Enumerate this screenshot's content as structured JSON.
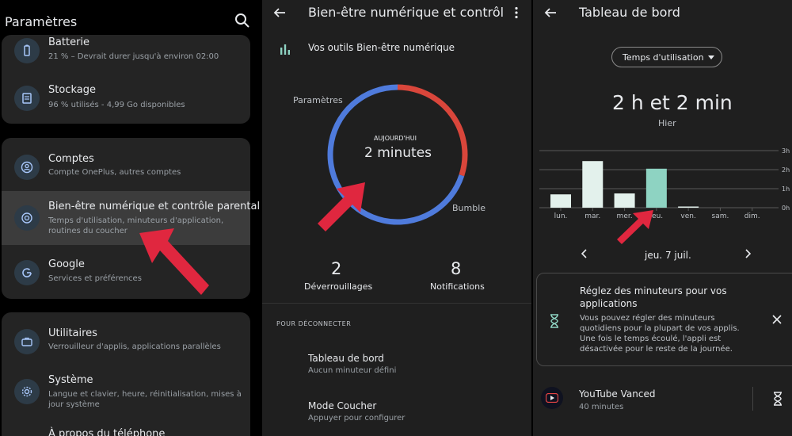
{
  "settings": {
    "title": "Paramètres",
    "items": [
      {
        "title": "Batterie",
        "subtitle": "21 % – Devrait durer jusqu'à environ 02:00"
      },
      {
        "title": "Stockage",
        "subtitle": "96 % utilisés - 4,99 Go disponibles"
      },
      {
        "title": "Comptes",
        "subtitle": "Compte OnePlus, autres comptes"
      },
      {
        "title": "Bien-être numérique et contrôle parental",
        "subtitle": "Temps d'utilisation, minuteurs d'application, routines du coucher"
      },
      {
        "title": "Google",
        "subtitle": "Services et préférences"
      },
      {
        "title": "Utilitaires",
        "subtitle": "Verrouilleur d'applis, applications parallèles"
      },
      {
        "title": "Système",
        "subtitle": "Langue et clavier, heure, réinitialisation, mises à jour système"
      },
      {
        "title": "À propos du téléphone",
        "subtitle": ""
      }
    ]
  },
  "wellbeing": {
    "title": "Bien-être numérique et contrôle parental",
    "tools_label": "Vos outils Bien-être numérique",
    "donut": {
      "today_label": "AUJOURD'HUI",
      "value": "2 minutes",
      "segments": [
        {
          "label": "Parametres",
          "fraction": 0.3,
          "color": "#d9463b"
        },
        {
          "label": "Bumble",
          "fraction": 0.7,
          "color": "#4f7bdc"
        }
      ]
    },
    "labels": {
      "parametres": "Paramètres",
      "bumble": "Bumble"
    },
    "stats": {
      "unlocks_value": "2",
      "unlocks_label": "Déverrouillages",
      "notifications_value": "8",
      "notifications_label": "Notifications"
    },
    "section_disconnect": "POUR DÉCONNECTER",
    "items": [
      {
        "title": "Tableau de bord",
        "subtitle": "Aucun minuteur défini"
      },
      {
        "title": "Mode Coucher",
        "subtitle": "Appuyer pour configurer"
      }
    ]
  },
  "dashboard": {
    "title": "Tableau de bord",
    "dropdown": "Temps d'utilisation",
    "total": "2 h et 2 min",
    "period": "Hier",
    "date_nav": "jeu. 7 juil.",
    "tip": {
      "title": "Réglez des minuteurs pour vos applications",
      "body": "Vous pouvez régler des minuteurs quotidiens pour la plupart de vos applis. Une fois le temps écoulé, l'appli est désactivée pour le reste de la journée."
    },
    "app": {
      "name": "YouTube Vanced",
      "usage": "40 minutes"
    }
  },
  "chart_data": {
    "type": "bar",
    "categories": [
      "lun.",
      "mar.",
      "mer.",
      "jeu.",
      "ven.",
      "sam.",
      "dim."
    ],
    "values": [
      0.7,
      2.45,
      0.75,
      2.05,
      0.05,
      0,
      0
    ],
    "selected": "jeu.",
    "ylabel": "",
    "yticks": [
      "0h",
      "1h",
      "2h",
      "3h"
    ],
    "ylim": [
      0,
      3
    ],
    "grid": true,
    "colors": {
      "default": "#e3f1ec",
      "selected": "#8ed3c2"
    }
  },
  "colors": {
    "arrow": "#e0273f",
    "accent_blue": "#4f7bdc",
    "accent_red": "#d9463b"
  }
}
